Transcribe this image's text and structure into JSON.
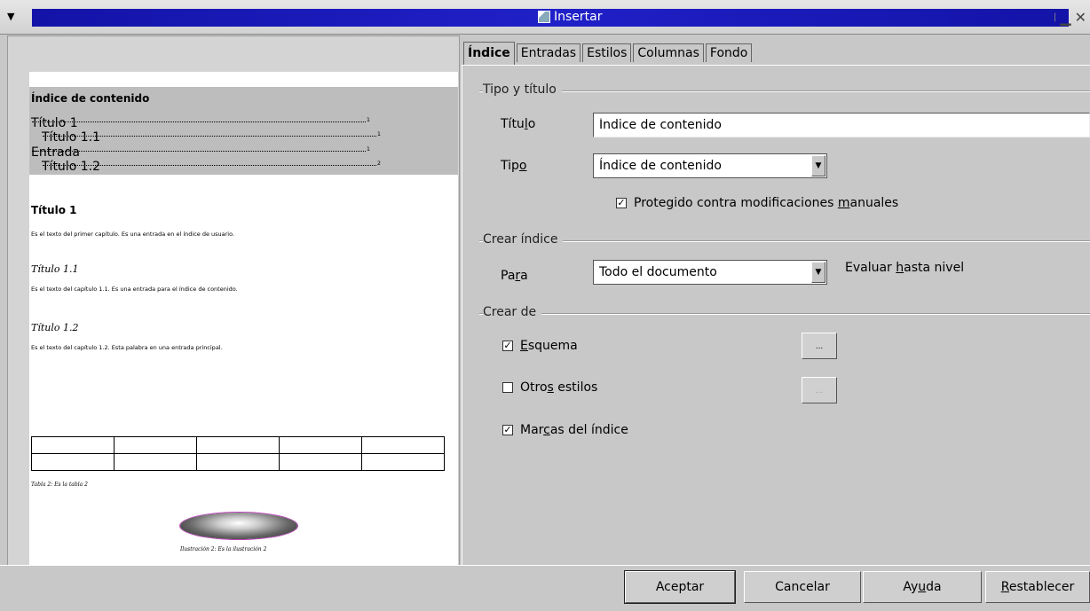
{
  "window": {
    "title": "Insertar",
    "menu_icon": "down-triangle-icon",
    "title_icon": "document-icon",
    "minimize_icon": "minimize-icon",
    "close_icon": "close-icon"
  },
  "preview": {
    "toc_title": "Índice de contenido",
    "toc_entries": [
      {
        "label": "Título 1",
        "page": "1"
      },
      {
        "label": "Título 1.1",
        "page": "1"
      },
      {
        "label": "Entrada",
        "page": "1"
      },
      {
        "label": "Título 1.2",
        "page": "2"
      }
    ],
    "heading1": "Título 1",
    "para1": "Es el texto del primer capítulo. Es una entrada en el índice de usuario.",
    "heading2": "Título 1.1",
    "para2": "Es el texto del capítulo 1.1. Es una entrada para el índice de contenido.",
    "heading3": "Título 1.2",
    "para3": "Es el texto del capítulo 1.2. Esta palabra en una entrada principal.",
    "table_caption": "Tabla 2: Es la tabla 2",
    "image_caption": "Ilustración 2: Es la ilustración 2"
  },
  "tabs": [
    "Índice",
    "Entradas",
    "Estilos",
    "Columnas",
    "Fondo"
  ],
  "type_title": {
    "group": "Tipo y título",
    "title_label": "Título",
    "title_value": "Índice de contenido",
    "type_label": "Tipo",
    "type_value": "Índice de contenido",
    "protected_label": "Protegido contra modificaciones manuales",
    "protected_checked": true
  },
  "create_index": {
    "group": "Crear índice",
    "for_label": "Para",
    "for_value": "Todo el documento",
    "eval_label": "Evaluar hasta nivel"
  },
  "create_from": {
    "group": "Crear de",
    "outline_label": "Esquema",
    "outline_checked": true,
    "other_styles_label": "Otros estilos",
    "other_styles_checked": false,
    "index_marks_label": "Marcas del índice",
    "index_marks_checked": true,
    "dots_label": "..."
  },
  "footer": {
    "ok": "Aceptar",
    "cancel": "Cancelar",
    "help": "Ayuda",
    "reset": "Restablecer"
  }
}
